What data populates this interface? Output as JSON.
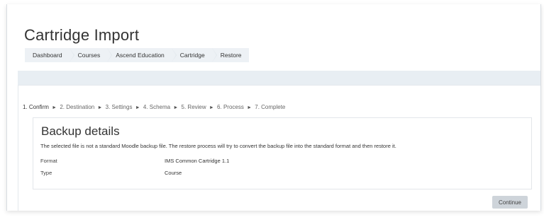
{
  "page": {
    "title": "Cartridge Import"
  },
  "breadcrumb": [
    "Dashboard",
    "Courses",
    "Ascend Education",
    "Cartridge",
    "Restore"
  ],
  "steps": [
    "1. Confirm",
    "2. Destination",
    "3. Settings",
    "4. Schema",
    "5. Review",
    "6. Process",
    "7. Complete"
  ],
  "step_separator": "►",
  "backup": {
    "title": "Backup details",
    "description": "The selected file is not a standard Moodle backup file. The restore process will try to convert the backup file into the standard format and then restore it.",
    "format_label": "Format",
    "format_value": "IMS Common Cartridge 1.1",
    "type_label": "Type",
    "type_value": "Course"
  },
  "actions": {
    "continue_label": "Continue"
  }
}
